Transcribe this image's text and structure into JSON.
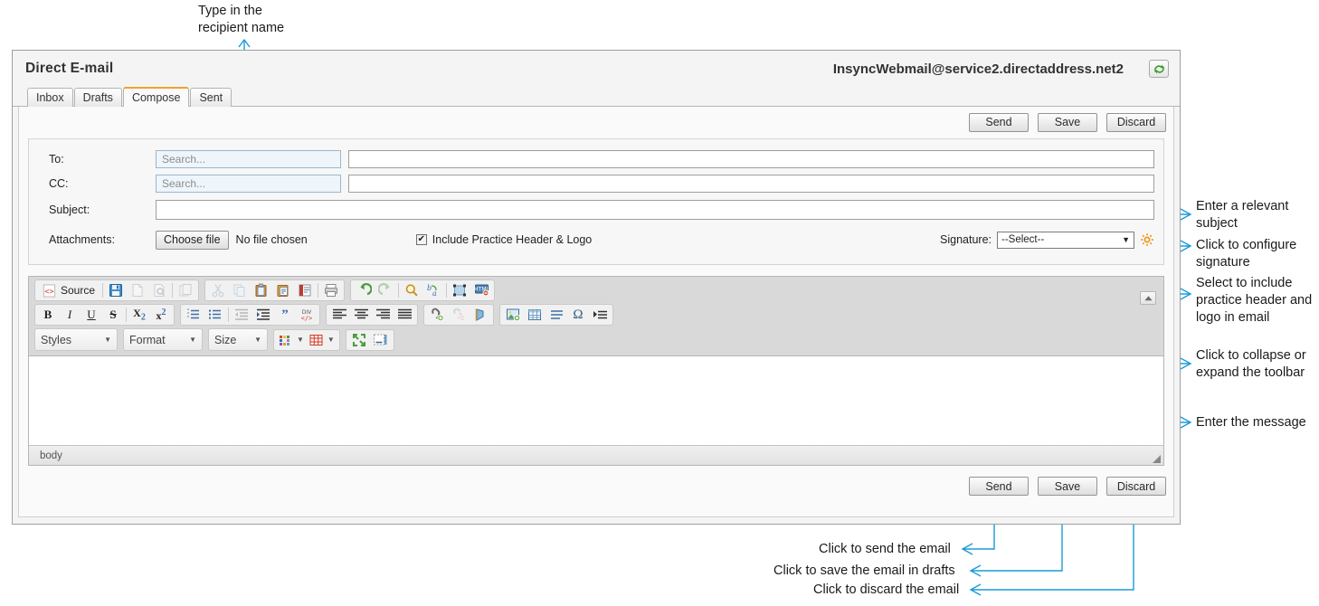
{
  "app": {
    "title": "Direct E-mail",
    "account_email": "InsyncWebmail@service2.directaddress.net2",
    "refresh_icon": "refresh-icon"
  },
  "tabs": [
    {
      "label": "Inbox",
      "active": false
    },
    {
      "label": "Drafts",
      "active": false
    },
    {
      "label": "Compose",
      "active": true
    },
    {
      "label": "Sent",
      "active": false
    }
  ],
  "actions": {
    "send": "Send",
    "save": "Save",
    "discard": "Discard"
  },
  "fields": {
    "to_label": "To:",
    "to_search_placeholder": "Search...",
    "to_search_value": "",
    "to_value": "",
    "cc_label": "CC:",
    "cc_search_placeholder": "Search...",
    "cc_search_value": "",
    "cc_value": "",
    "subject_label": "Subject:",
    "subject_value": "",
    "subject_placeholder": "",
    "attachments_label": "Attachments:",
    "choose_file_label": "Choose file",
    "no_file_chosen": "No file chosen",
    "include_header_label": "Include Practice Header & Logo",
    "include_header_checked": true,
    "include_header_checkmark": "✔",
    "signature_label": "Signature:",
    "signature_value": "--Select--",
    "signature_caret": "▼",
    "signature_gear_icon": "gear-icon"
  },
  "editor": {
    "source_label": "Source",
    "styles_label": "Styles",
    "format_label": "Format",
    "size_label": "Size",
    "combo_caret": "▼",
    "status_text": "body",
    "body_value": "",
    "collapse_icon": "collapse-up-icon",
    "resize_grip": "resize-grip",
    "toolbar_row1": [
      "source-icon",
      "save-icon",
      "new-page-icon",
      "preview-icon",
      "templates-icon",
      "cut-icon",
      "copy-icon",
      "paste-icon",
      "paste-text-icon",
      "paste-word-icon",
      "print-icon",
      "undo-icon",
      "redo-icon",
      "find-icon",
      "replace-icon",
      "select-all-icon",
      "remove-format-icon"
    ],
    "toolbar_row2": [
      "bold-icon",
      "italic-icon",
      "underline-icon",
      "strikethrough-icon",
      "subscript-icon",
      "superscript-icon",
      "numbered-list-icon",
      "bulleted-list-icon",
      "outdent-icon",
      "indent-icon",
      "blockquote-icon",
      "div-container-icon",
      "align-left-icon",
      "align-center-icon",
      "align-right-icon",
      "align-justify-icon",
      "link-icon",
      "unlink-icon",
      "anchor-icon",
      "image-icon",
      "table-icon",
      "horizontal-rule-icon",
      "special-char-icon",
      "page-break-icon"
    ],
    "toolbar_row3": [
      "styles-dropdown",
      "format-dropdown",
      "size-dropdown",
      "text-color-icon",
      "background-color-icon",
      "maximize-icon",
      "show-blocks-icon"
    ]
  },
  "annotations": [
    {
      "name": "recipient-name-callout",
      "text": "Type in the\nrecipient name"
    },
    {
      "name": "subject-callout",
      "text": "Enter a relevant\nsubject"
    },
    {
      "name": "signature-callout",
      "text": "Click to configure\nsignature"
    },
    {
      "name": "practice-header-callout",
      "text": "Select to include\npractice header and\nlogo in email"
    },
    {
      "name": "toolbar-collapse-callout",
      "text": "Click to collapse or\nexpand the toolbar"
    },
    {
      "name": "message-callout",
      "text": "Enter the message"
    },
    {
      "name": "send-callout",
      "text": "Click to send the email"
    },
    {
      "name": "save-callout",
      "text": "Click to save the email in drafts"
    },
    {
      "name": "discard-callout",
      "text": "Click to discard the email"
    }
  ],
  "colors": {
    "annotation_line": "#1a9bd7",
    "active_tab_accent": "#f0a030",
    "gear": "#f2941f",
    "search_field_bg": "#eef5fb",
    "window_border": "#9e9e9e"
  }
}
